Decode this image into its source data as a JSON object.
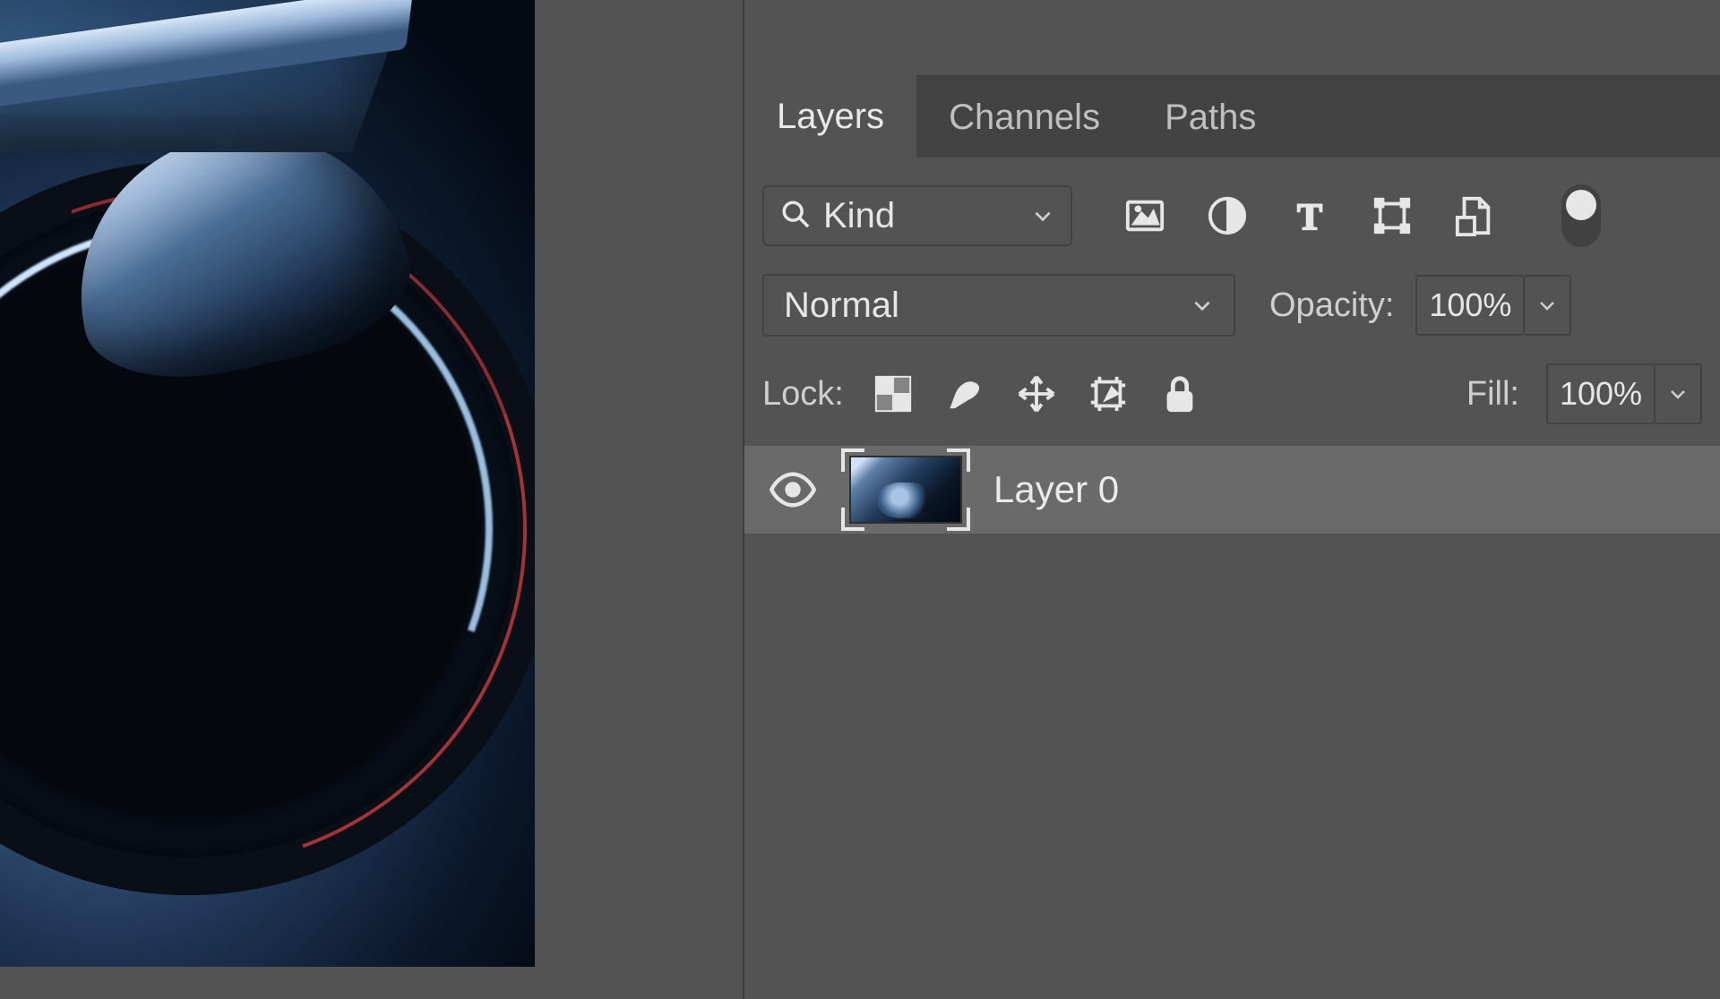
{
  "tabs": {
    "layers": "Layers",
    "channels": "Channels",
    "paths": "Paths",
    "active": "layers"
  },
  "filter": {
    "kind_label": "Kind"
  },
  "blend": {
    "mode": "Normal",
    "opacity_label": "Opacity:",
    "opacity_value": "100%"
  },
  "lock": {
    "label": "Lock:",
    "fill_label": "Fill:",
    "fill_value": "100%"
  },
  "layers": [
    {
      "name": "Layer 0",
      "visible": true
    }
  ]
}
